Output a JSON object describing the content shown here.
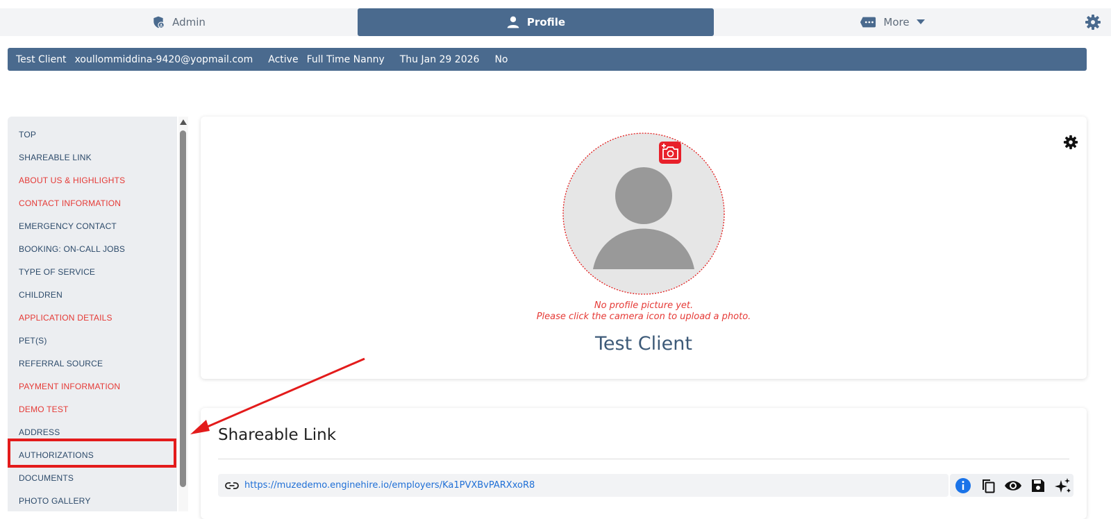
{
  "topnav": {
    "admin_label": "Admin",
    "profile_label": "Profile",
    "more_label": "More"
  },
  "infobar": {
    "name": "Test Client",
    "email": "xoullommiddina-9420@yopmail.com",
    "status": "Active",
    "service": "Full Time Nanny",
    "date": "Thu Jan 29 2026",
    "flag": "No"
  },
  "sidebar": {
    "items": [
      {
        "label": "TOP",
        "color": "#2c4a6a"
      },
      {
        "label": "SHAREABLE LINK",
        "color": "#2c4a6a"
      },
      {
        "label": "ABOUT US & HIGHLIGHTS",
        "color": "#e53935"
      },
      {
        "label": "CONTACT INFORMATION",
        "color": "#e53935"
      },
      {
        "label": "EMERGENCY CONTACT",
        "color": "#2c4a6a"
      },
      {
        "label": "BOOKING: ON-CALL JOBS",
        "color": "#2c4a6a"
      },
      {
        "label": "TYPE OF SERVICE",
        "color": "#2c4a6a"
      },
      {
        "label": "CHILDREN",
        "color": "#2c4a6a"
      },
      {
        "label": "APPLICATION DETAILS",
        "color": "#e53935"
      },
      {
        "label": "PET(S)",
        "color": "#2c4a6a"
      },
      {
        "label": "REFERRAL SOURCE",
        "color": "#2c4a6a"
      },
      {
        "label": "PAYMENT INFORMATION",
        "color": "#e53935"
      },
      {
        "label": "DEMO TEST",
        "color": "#e53935"
      },
      {
        "label": "ADDRESS",
        "color": "#2c4a6a"
      },
      {
        "label": "AUTHORIZATIONS",
        "color": "#2c4a6a"
      },
      {
        "label": "DOCUMENTS",
        "color": "#2c4a6a"
      },
      {
        "label": "PHOTO GALLERY",
        "color": "#2c4a6a"
      }
    ]
  },
  "profile": {
    "no_picture_line1": "No profile picture yet.",
    "no_picture_line2": "Please click the camera icon to upload a photo.",
    "client_name": "Test Client"
  },
  "shareable": {
    "title": "Shareable Link",
    "url": "https://muzedemo.enginehire.io/employers/Ka1PVXBvPARXxoR8"
  },
  "colors": {
    "brand": "#4a6a8e",
    "alert": "#e53935",
    "highlight": "#e31b1b"
  }
}
